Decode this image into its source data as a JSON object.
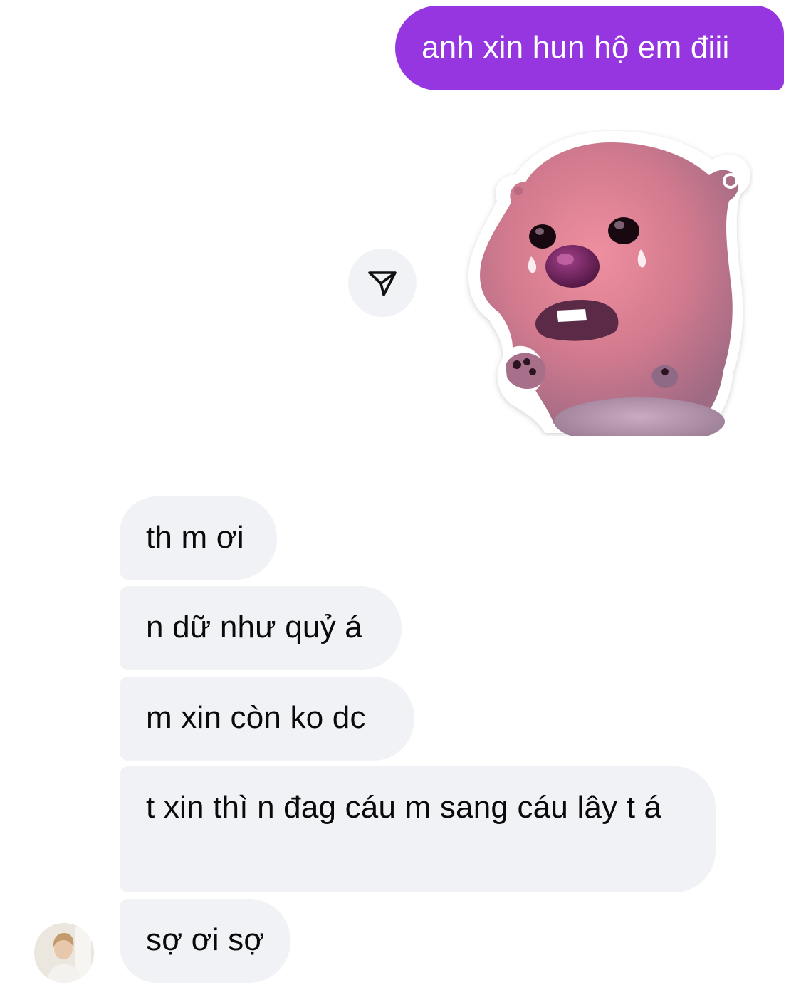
{
  "messages": {
    "outgoing": [
      {
        "text": "anh xin hun hộ em điii"
      }
    ],
    "incoming": [
      {
        "text": "th m ơi"
      },
      {
        "text": "n dữ như quỷ á"
      },
      {
        "text": "m xin còn ko dc"
      },
      {
        "text": "t xin thì n đag cáu m sang cáu lây t á"
      },
      {
        "text": "sợ ơi sợ"
      }
    ]
  },
  "sticker": {
    "icon": "crying-beaver-sticker"
  },
  "share_button": {
    "icon": "send-arrow-icon"
  },
  "avatar": {
    "icon": "user-avatar"
  },
  "colors": {
    "outgoing_bubble": "#9536e0",
    "incoming_bubble": "#f1f2f5",
    "background": "#ffffff"
  }
}
